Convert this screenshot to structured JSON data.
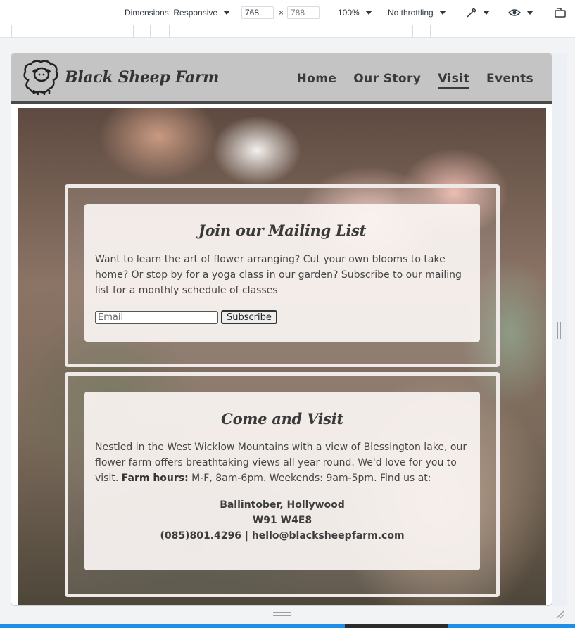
{
  "devtools": {
    "dimensions_label": "Dimensions: Responsive",
    "width_value": "768",
    "height_placeholder": "788",
    "times": "×",
    "zoom_label": "100%",
    "throttling_label": "No throttling"
  },
  "site": {
    "logo_text": "Black Sheep Farm",
    "nav": {
      "home": "Home",
      "story": "Our Story",
      "visit": "Visit",
      "events": "Events"
    }
  },
  "mailing": {
    "title": "Join our Mailing List",
    "text": "Want to learn the art of flower arranging? Cut your own blooms to take home? Or stop by for a yoga class in our garden? Subscribe to our mailing list for a monthly schedule of classes",
    "email_placeholder": "Email",
    "subscribe_label": "Subscribe"
  },
  "visit": {
    "title": "Come and Visit",
    "intro": "Nestled in the West Wicklow Mountains with a view of Blessington lake, our flower farm offers breathtaking views all year round. We'd love for you to visit.",
    "hours_label": "Farm hours:",
    "hours_text": "M-F, 8am-6pm. Weekends: 9am-5pm. Find us at:",
    "address_line1": "Ballintober, Hollywood",
    "address_line2": "W91 W4E8",
    "contact_line": "(085)801.4296 | hello@blacksheepfarm.com"
  },
  "colors": {
    "header_bg": "#c4c4c4",
    "card_border": "#efe9e7",
    "taskbar": "#1f8ee8"
  },
  "icons": [
    "sheep-logo-icon",
    "caret-down-icon",
    "color-picker-icon",
    "eye-icon",
    "device-rotate-icon"
  ]
}
